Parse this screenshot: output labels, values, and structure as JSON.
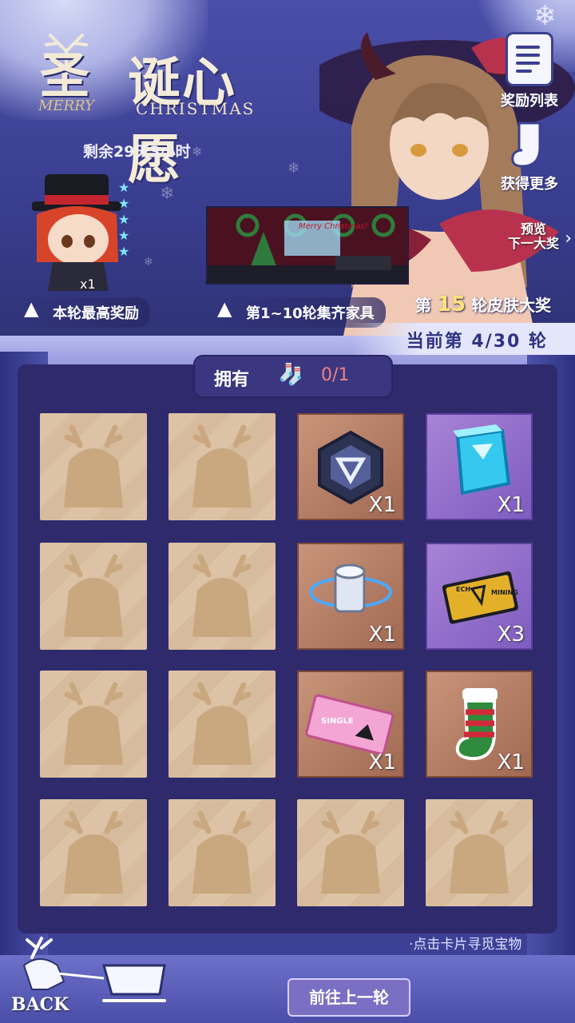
{
  "header": {
    "title_cn_1": "圣",
    "title_cn_2": "诞心愿",
    "title_en_1": "MERRY",
    "title_en_2": "CHRISTMAS",
    "countdown": "剩余29天3小时"
  },
  "side_buttons": {
    "rewards_list": "奖励列表",
    "get_more": "获得更多"
  },
  "rewards": {
    "top_reward_label": "本轮最高奖励",
    "chibi_qty": "x1",
    "furniture_label": "第1~10轮集齐家具",
    "furniture_sign": "Merry Christmas!",
    "round_prize_prefix": "第",
    "round_prize_num": "15",
    "round_prize_suffix": "轮皮肤大奖",
    "preview_line1": "预览",
    "preview_line2": "下一大奖"
  },
  "round": {
    "text": "当前第  4/30  轮"
  },
  "board": {
    "own_label": "拥有",
    "own_count": "0/1",
    "cards": [
      {
        "state": "hidden",
        "qty": ""
      },
      {
        "state": "hidden",
        "qty": ""
      },
      {
        "state": "revealed",
        "tier": "brown",
        "item": "core-chip-icon",
        "qty": "X1"
      },
      {
        "state": "revealed",
        "tier": "purple",
        "item": "blue-cube-icon",
        "qty": "X1"
      },
      {
        "state": "hidden",
        "qty": ""
      },
      {
        "state": "hidden",
        "qty": ""
      },
      {
        "state": "revealed",
        "tier": "brown",
        "item": "cylinder-module-icon",
        "qty": "X1"
      },
      {
        "state": "revealed",
        "tier": "purple",
        "item": "gold-card-icon",
        "qty": "X3"
      },
      {
        "state": "hidden",
        "qty": ""
      },
      {
        "state": "hidden",
        "qty": ""
      },
      {
        "state": "revealed",
        "tier": "brown",
        "item": "pink-ticket-icon",
        "qty": "X1"
      },
      {
        "state": "revealed",
        "tier": "brown",
        "item": "christmas-sock-icon",
        "qty": "X1"
      },
      {
        "state": "hidden",
        "qty": ""
      },
      {
        "state": "hidden",
        "qty": ""
      },
      {
        "state": "hidden",
        "qty": ""
      },
      {
        "state": "hidden",
        "qty": ""
      }
    ],
    "gold_card_text_1": "ECH",
    "gold_card_text_2": "MINING",
    "ticket_text": "SINGLE"
  },
  "footer": {
    "hint": "·点击卡片寻觅宝物",
    "prev_round": "前往上一轮",
    "back": "BACK"
  },
  "colors": {
    "bg": "#3a3a86",
    "board": "#2f2a6c",
    "count_red": "#f08080",
    "prize_yellow": "#ffe27a"
  }
}
